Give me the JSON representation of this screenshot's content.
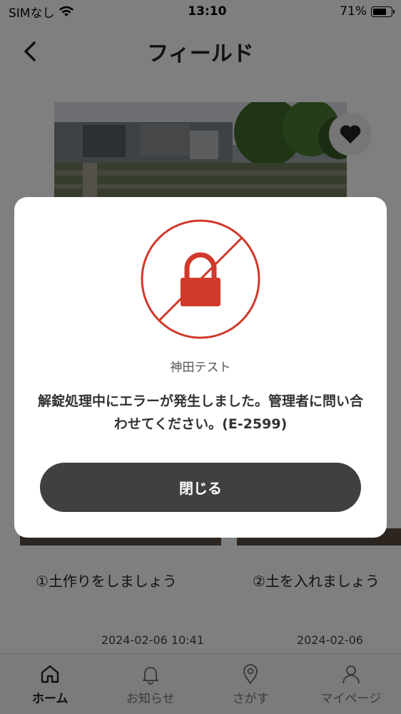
{
  "status_bar": {
    "carrier": "SIMなし",
    "time": "13:10",
    "battery": "71%"
  },
  "header": {
    "title": "フィールド"
  },
  "cards": [
    {
      "title": "①土作りをしましょう",
      "date": "2024-02-06 10:41"
    },
    {
      "title": "②土を入れましょう",
      "date": "2024-02-06"
    }
  ],
  "tabbar": {
    "items": [
      {
        "label": "ホーム",
        "icon": "home-icon",
        "active": true
      },
      {
        "label": "お知らせ",
        "icon": "bell-icon",
        "active": false
      },
      {
        "label": "さがす",
        "icon": "location-pin-icon",
        "active": false
      },
      {
        "label": "マイページ",
        "icon": "user-icon",
        "active": false
      }
    ]
  },
  "modal": {
    "facility": "神田テスト",
    "message": "解錠処理中にエラーが発生しました。管理者に問い合わせてください。(E-2599)",
    "close_label": "閉じる",
    "icon": "lock-prohibited-icon",
    "accent_color": "#d0392b"
  }
}
